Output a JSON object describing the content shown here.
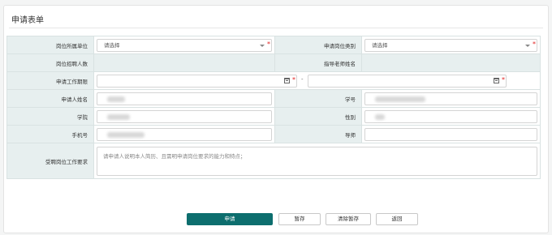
{
  "panel": {
    "title": "申请表单"
  },
  "form": {
    "dept_label": "岗位所属单位",
    "dept_placeholder": "请选择",
    "type_label": "申请岗位类别",
    "type_placeholder": "请选择",
    "count_label": "岗位招聘人数",
    "count_value": "",
    "teacher_label": "指导老师姓名",
    "teacher_value": "",
    "period_label": "申请工作期限",
    "period_sep": "-",
    "applicant_label": "申请人姓名",
    "student_id_label": "学号",
    "college_label": "学院",
    "gender_label": "性别",
    "phone_label": "手机号",
    "mentor_label": "导师",
    "requirement_label": "受聘岗位工作要求",
    "requirement_placeholder": "请申请人说明本人简历、且需明申请岗位要求的能力和特点；",
    "required_mark": "*"
  },
  "buttons": {
    "apply": "申请",
    "save": "暂存",
    "clear": "清除暂存",
    "back": "返回"
  }
}
